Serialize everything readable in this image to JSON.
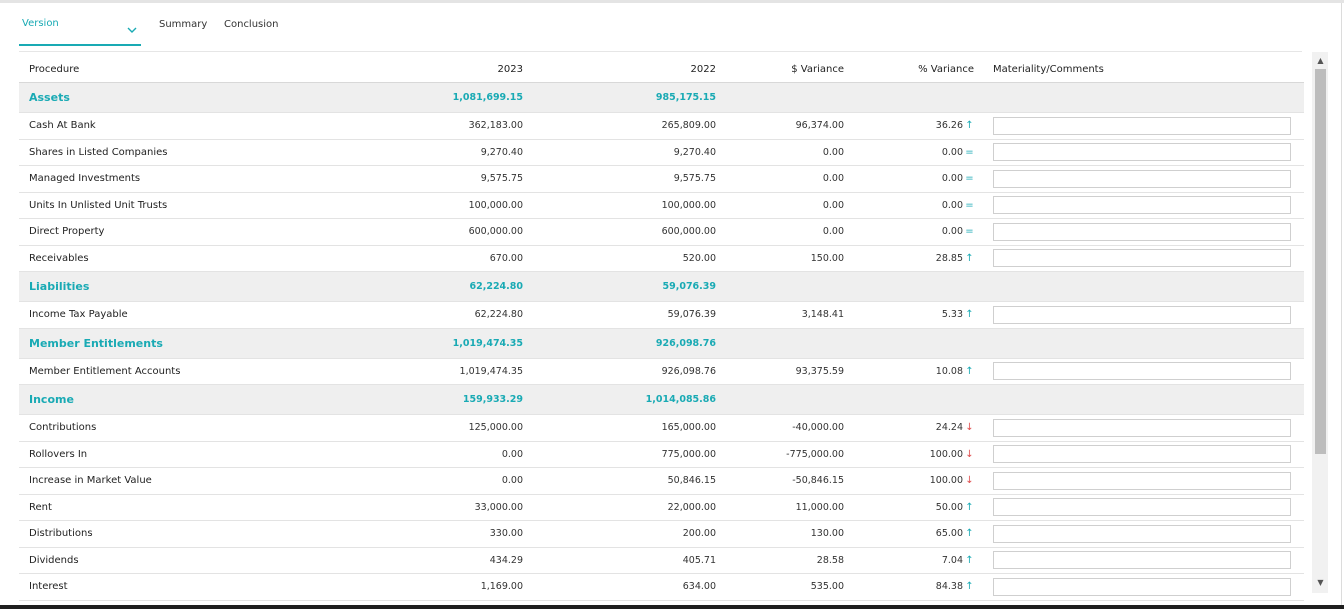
{
  "tabs": {
    "version_label": "Version",
    "summary_label": "Summary",
    "conclusion_label": "Conclusion"
  },
  "table": {
    "headers": {
      "procedure": "Procedure",
      "y2023": "2023",
      "y2022": "2022",
      "variance": "$ Variance",
      "pct_variance": "% Variance",
      "comments": "Materiality/Comments"
    },
    "rows": [
      {
        "type": "section",
        "procedure": "Assets",
        "y2023": "1,081,699.15",
        "y2022": "985,175.15"
      },
      {
        "type": "item",
        "procedure": "Cash At Bank",
        "y2023": "362,183.00",
        "y2022": "265,809.00",
        "variance": "96,374.00",
        "pct": "36.26",
        "dir": "up"
      },
      {
        "type": "item",
        "procedure": "Shares in Listed Companies",
        "y2023": "9,270.40",
        "y2022": "9,270.40",
        "variance": "0.00",
        "pct": "0.00",
        "dir": "eq"
      },
      {
        "type": "item",
        "procedure": "Managed Investments",
        "y2023": "9,575.75",
        "y2022": "9,575.75",
        "variance": "0.00",
        "pct": "0.00",
        "dir": "eq"
      },
      {
        "type": "item",
        "procedure": "Units In Unlisted Unit Trusts",
        "y2023": "100,000.00",
        "y2022": "100,000.00",
        "variance": "0.00",
        "pct": "0.00",
        "dir": "eq"
      },
      {
        "type": "item",
        "procedure": "Direct Property",
        "y2023": "600,000.00",
        "y2022": "600,000.00",
        "variance": "0.00",
        "pct": "0.00",
        "dir": "eq"
      },
      {
        "type": "item",
        "procedure": "Receivables",
        "y2023": "670.00",
        "y2022": "520.00",
        "variance": "150.00",
        "pct": "28.85",
        "dir": "up"
      },
      {
        "type": "section",
        "procedure": "Liabilities",
        "y2023": "62,224.80",
        "y2022": "59,076.39"
      },
      {
        "type": "item",
        "procedure": "Income Tax Payable",
        "y2023": "62,224.80",
        "y2022": "59,076.39",
        "variance": "3,148.41",
        "pct": "5.33",
        "dir": "up"
      },
      {
        "type": "section",
        "procedure": "Member Entitlements",
        "y2023": "1,019,474.35",
        "y2022": "926,098.76"
      },
      {
        "type": "item",
        "procedure": "Member Entitlement Accounts",
        "y2023": "1,019,474.35",
        "y2022": "926,098.76",
        "variance": "93,375.59",
        "pct": "10.08",
        "dir": "up"
      },
      {
        "type": "section",
        "procedure": "Income",
        "y2023": "159,933.29",
        "y2022": "1,014,085.86"
      },
      {
        "type": "item",
        "procedure": "Contributions",
        "y2023": "125,000.00",
        "y2022": "165,000.00",
        "variance": "-40,000.00",
        "pct": "24.24",
        "dir": "down"
      },
      {
        "type": "item",
        "procedure": "Rollovers In",
        "y2023": "0.00",
        "y2022": "775,000.00",
        "variance": "-775,000.00",
        "pct": "100.00",
        "dir": "down"
      },
      {
        "type": "item",
        "procedure": "Increase in Market Value",
        "y2023": "0.00",
        "y2022": "50,846.15",
        "variance": "-50,846.15",
        "pct": "100.00",
        "dir": "down"
      },
      {
        "type": "item",
        "procedure": "Rent",
        "y2023": "33,000.00",
        "y2022": "22,000.00",
        "variance": "11,000.00",
        "pct": "50.00",
        "dir": "up"
      },
      {
        "type": "item",
        "procedure": "Distributions",
        "y2023": "330.00",
        "y2022": "200.00",
        "variance": "130.00",
        "pct": "65.00",
        "dir": "up"
      },
      {
        "type": "item",
        "procedure": "Dividends",
        "y2023": "434.29",
        "y2022": "405.71",
        "variance": "28.58",
        "pct": "7.04",
        "dir": "up"
      },
      {
        "type": "item",
        "procedure": "Interest",
        "y2023": "1,169.00",
        "y2022": "634.00",
        "variance": "535.00",
        "pct": "84.38",
        "dir": "up"
      }
    ]
  },
  "arrows": {
    "up": "↑",
    "down": "↓",
    "eq": "="
  },
  "colors": {
    "accent": "#19aab4",
    "down": "#e05050",
    "section_bg": "#efefef"
  }
}
